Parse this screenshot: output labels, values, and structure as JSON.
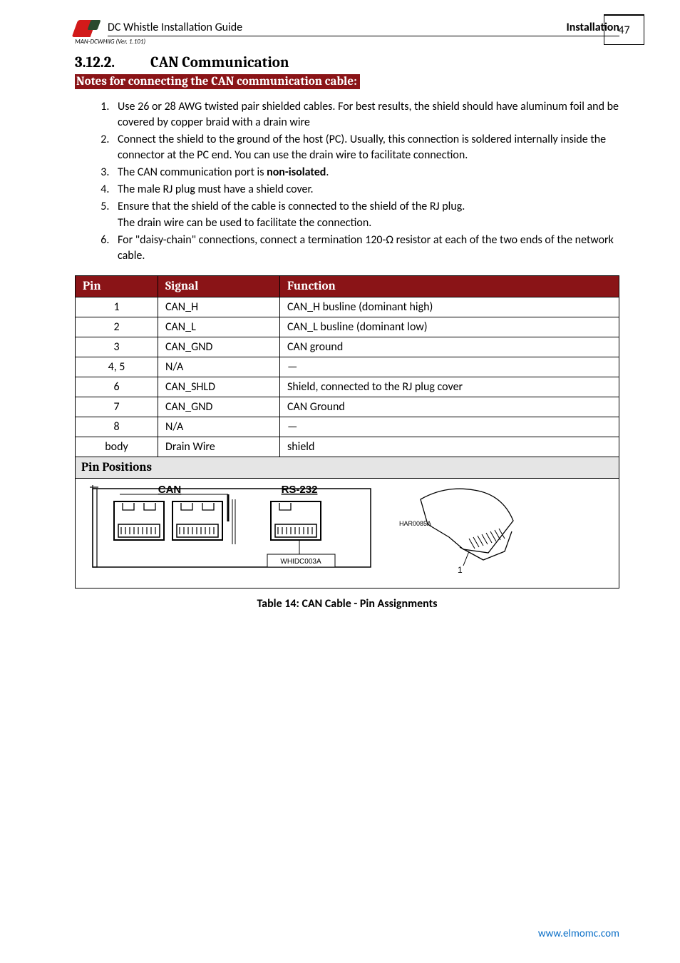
{
  "header": {
    "doc_title": "DC Whistle Installation Guide",
    "breadcrumb": "Installation",
    "version_line": "MAN-DCWHIIG (Ver. 1.101)",
    "page_number": "47"
  },
  "section": {
    "number": "3.12.2.",
    "title": "CAN Communication",
    "notes_bar": "Notes for connecting the CAN communication cable:"
  },
  "list": {
    "i1": "Use 26 or 28 AWG twisted pair shielded cables. For best results, the shield should have aluminum foil and be covered by copper braid with a drain wire",
    "i2": "Connect the shield to the ground of the host (PC). Usually, this connection is soldered internally inside the connector at the PC end. You can use the drain wire to facilitate connection.",
    "i3a": "The CAN communication port is ",
    "i3b": "non-isolated",
    "i3c": ".",
    "i4": "The male RJ plug must have a shield cover.",
    "i5a": "Ensure that the shield of the cable is connected to the shield of the RJ plug.",
    "i5b": "The drain wire can be used to facilitate the connection.",
    "i6": "For \"daisy-chain\" connections, connect a termination 120-Ω resistor at each of the two ends of the network cable."
  },
  "table": {
    "headers": {
      "pin": "Pin",
      "signal": "Signal",
      "function": "Function"
    },
    "rows": [
      {
        "pin": "1",
        "signal": "CAN_H",
        "func": "CAN_H busline (dominant high)"
      },
      {
        "pin": "2",
        "signal": "CAN_L",
        "func": "CAN_L busline (dominant low)"
      },
      {
        "pin": "3",
        "signal": "CAN_GND",
        "func": "CAN ground"
      },
      {
        "pin": "4, 5",
        "signal": "N/A",
        "func": "—"
      },
      {
        "pin": "6",
        "signal": "CAN_SHLD",
        "func": "Shield, connected to the RJ plug cover"
      },
      {
        "pin": "7",
        "signal": "CAN_GND",
        "func": "CAN Ground"
      },
      {
        "pin": "8",
        "signal": "N/A",
        "func": "—"
      },
      {
        "pin": "body",
        "signal": "Drain Wire",
        "func": "shield"
      }
    ],
    "positions_label": "Pin Positions"
  },
  "diagram": {
    "label_can": "CAN",
    "label_rs232": "RS-232",
    "ref_left": "WHIDC003A",
    "ref_right": "HAR0085A",
    "pin1": "1"
  },
  "chart_data": {
    "type": "table",
    "title": "Table 14: CAN Cable - Pin Assignments",
    "columns": [
      "Pin",
      "Signal",
      "Function"
    ],
    "rows": [
      [
        "1",
        "CAN_H",
        "CAN_H busline (dominant high)"
      ],
      [
        "2",
        "CAN_L",
        "CAN_L busline (dominant low)"
      ],
      [
        "3",
        "CAN_GND",
        "CAN ground"
      ],
      [
        "4, 5",
        "N/A",
        "—"
      ],
      [
        "6",
        "CAN_SHLD",
        "Shield, connected to the RJ plug cover"
      ],
      [
        "7",
        "CAN_GND",
        "CAN Ground"
      ],
      [
        "8",
        "N/A",
        "—"
      ],
      [
        "body",
        "Drain Wire",
        "shield"
      ]
    ]
  },
  "caption": "Table 14: CAN Cable - Pin Assignments",
  "footer_url": "www.elmomc.com"
}
